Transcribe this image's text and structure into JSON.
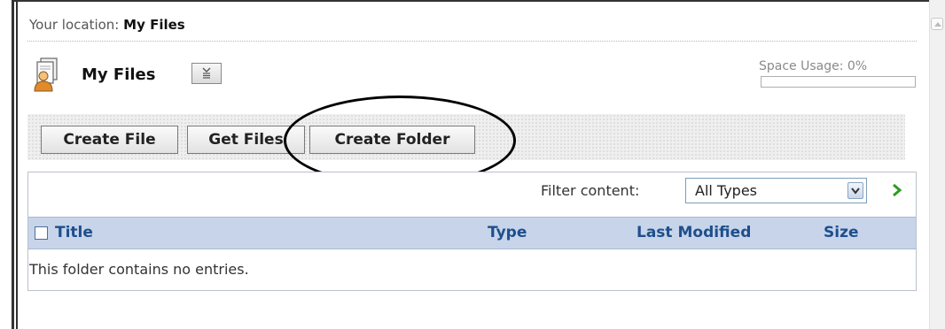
{
  "location": {
    "prefix": "Your location:",
    "current": "My Files"
  },
  "header": {
    "title": "My Files",
    "icon": "user-files-icon",
    "menu_icon": "dropdown-menu-icon"
  },
  "space_usage": {
    "label": "Space Usage: 0%",
    "percent": 0
  },
  "toolbar": {
    "buttons": [
      {
        "label": "Create File"
      },
      {
        "label": "Get Files"
      },
      {
        "label": "Create Folder"
      }
    ]
  },
  "filter": {
    "label": "Filter content:",
    "selected": "All Types",
    "go_icon": "go-arrow-icon"
  },
  "table": {
    "columns": [
      "Title",
      "Type",
      "Last Modified",
      "Size"
    ],
    "empty_message": "This folder contains no entries."
  },
  "colors": {
    "header_bg": "#c7d4ea",
    "header_text": "#1e4f8c",
    "go_arrow": "#2f9a23",
    "annotation_oval": "#000000"
  }
}
